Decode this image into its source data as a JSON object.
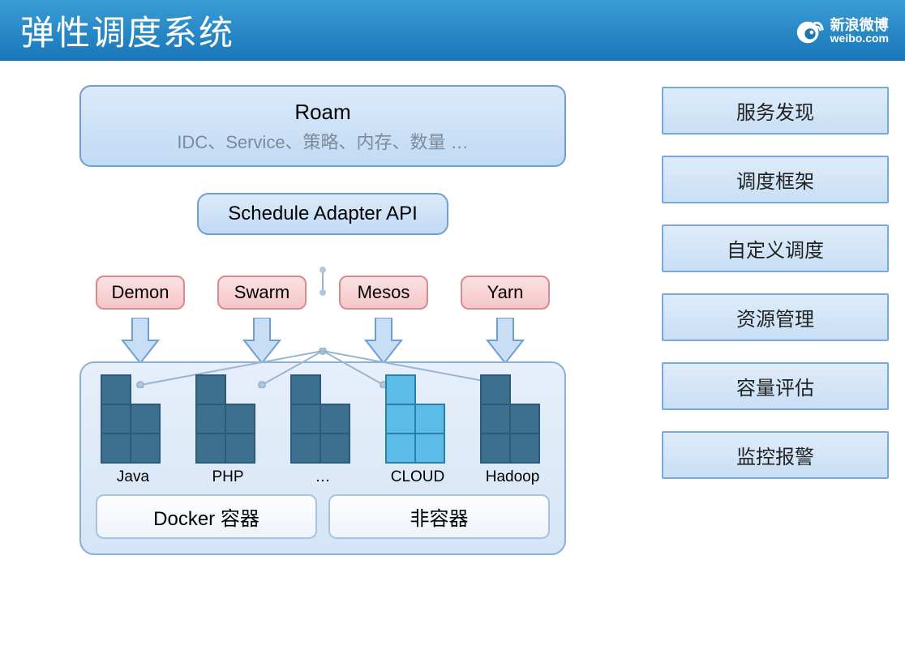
{
  "header": {
    "title": "弹性调度系统",
    "brand_cn": "新浪微博",
    "brand_en": "weibo.com"
  },
  "sidebar": [
    "服务发现",
    "调度框架",
    "自定义调度",
    "资源管理",
    "容量评估",
    "监控报警"
  ],
  "roam": {
    "title": "Roam",
    "subtitle": "IDC、Service、策略、内存、数量 …"
  },
  "adapter": "Schedule Adapter API",
  "schedulers": [
    "Demon",
    "Swarm",
    "Mesos",
    "Yarn"
  ],
  "clusters": [
    {
      "label": "Java",
      "color": "dark"
    },
    {
      "label": "PHP",
      "color": "dark"
    },
    {
      "label": "…",
      "color": "dark"
    },
    {
      "label": "CLOUD",
      "color": "light"
    },
    {
      "label": "Hadoop",
      "color": "dark"
    }
  ],
  "categories": [
    "Docker 容器",
    "非容器"
  ]
}
